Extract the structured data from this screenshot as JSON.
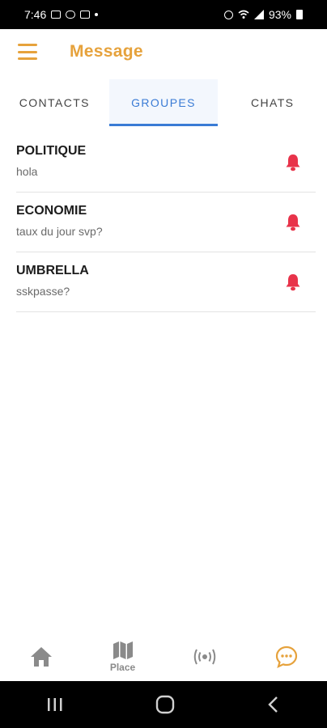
{
  "status_bar": {
    "time": "7:46",
    "battery": "93%"
  },
  "header": {
    "title": "Message",
    "menu_icon": "hamburger-menu-icon",
    "accent_color": "#e6a23c"
  },
  "tabs": [
    {
      "label": "CONTACTS",
      "active": false
    },
    {
      "label": "GROUPES",
      "active": true
    },
    {
      "label": "CHATS",
      "active": false
    }
  ],
  "groups": [
    {
      "name": "POLITIQUE",
      "last_message": "hola",
      "icon": "bell-icon"
    },
    {
      "name": "ECONOMIE",
      "last_message": "taux du jour svp?",
      "icon": "bell-icon"
    },
    {
      "name": "UMBRELLA",
      "last_message": "sskpasse?",
      "icon": "bell-icon"
    }
  ],
  "bottom_nav": [
    {
      "icon": "home-icon",
      "label": ""
    },
    {
      "icon": "map-icon",
      "label": "Place"
    },
    {
      "icon": "broadcast-icon",
      "label": ""
    },
    {
      "icon": "chat-icon",
      "label": "",
      "active": true
    }
  ],
  "colors": {
    "tab_active": "#3a7bd5",
    "bell": "#e8334a",
    "nav_inactive": "#8a8a8a"
  }
}
